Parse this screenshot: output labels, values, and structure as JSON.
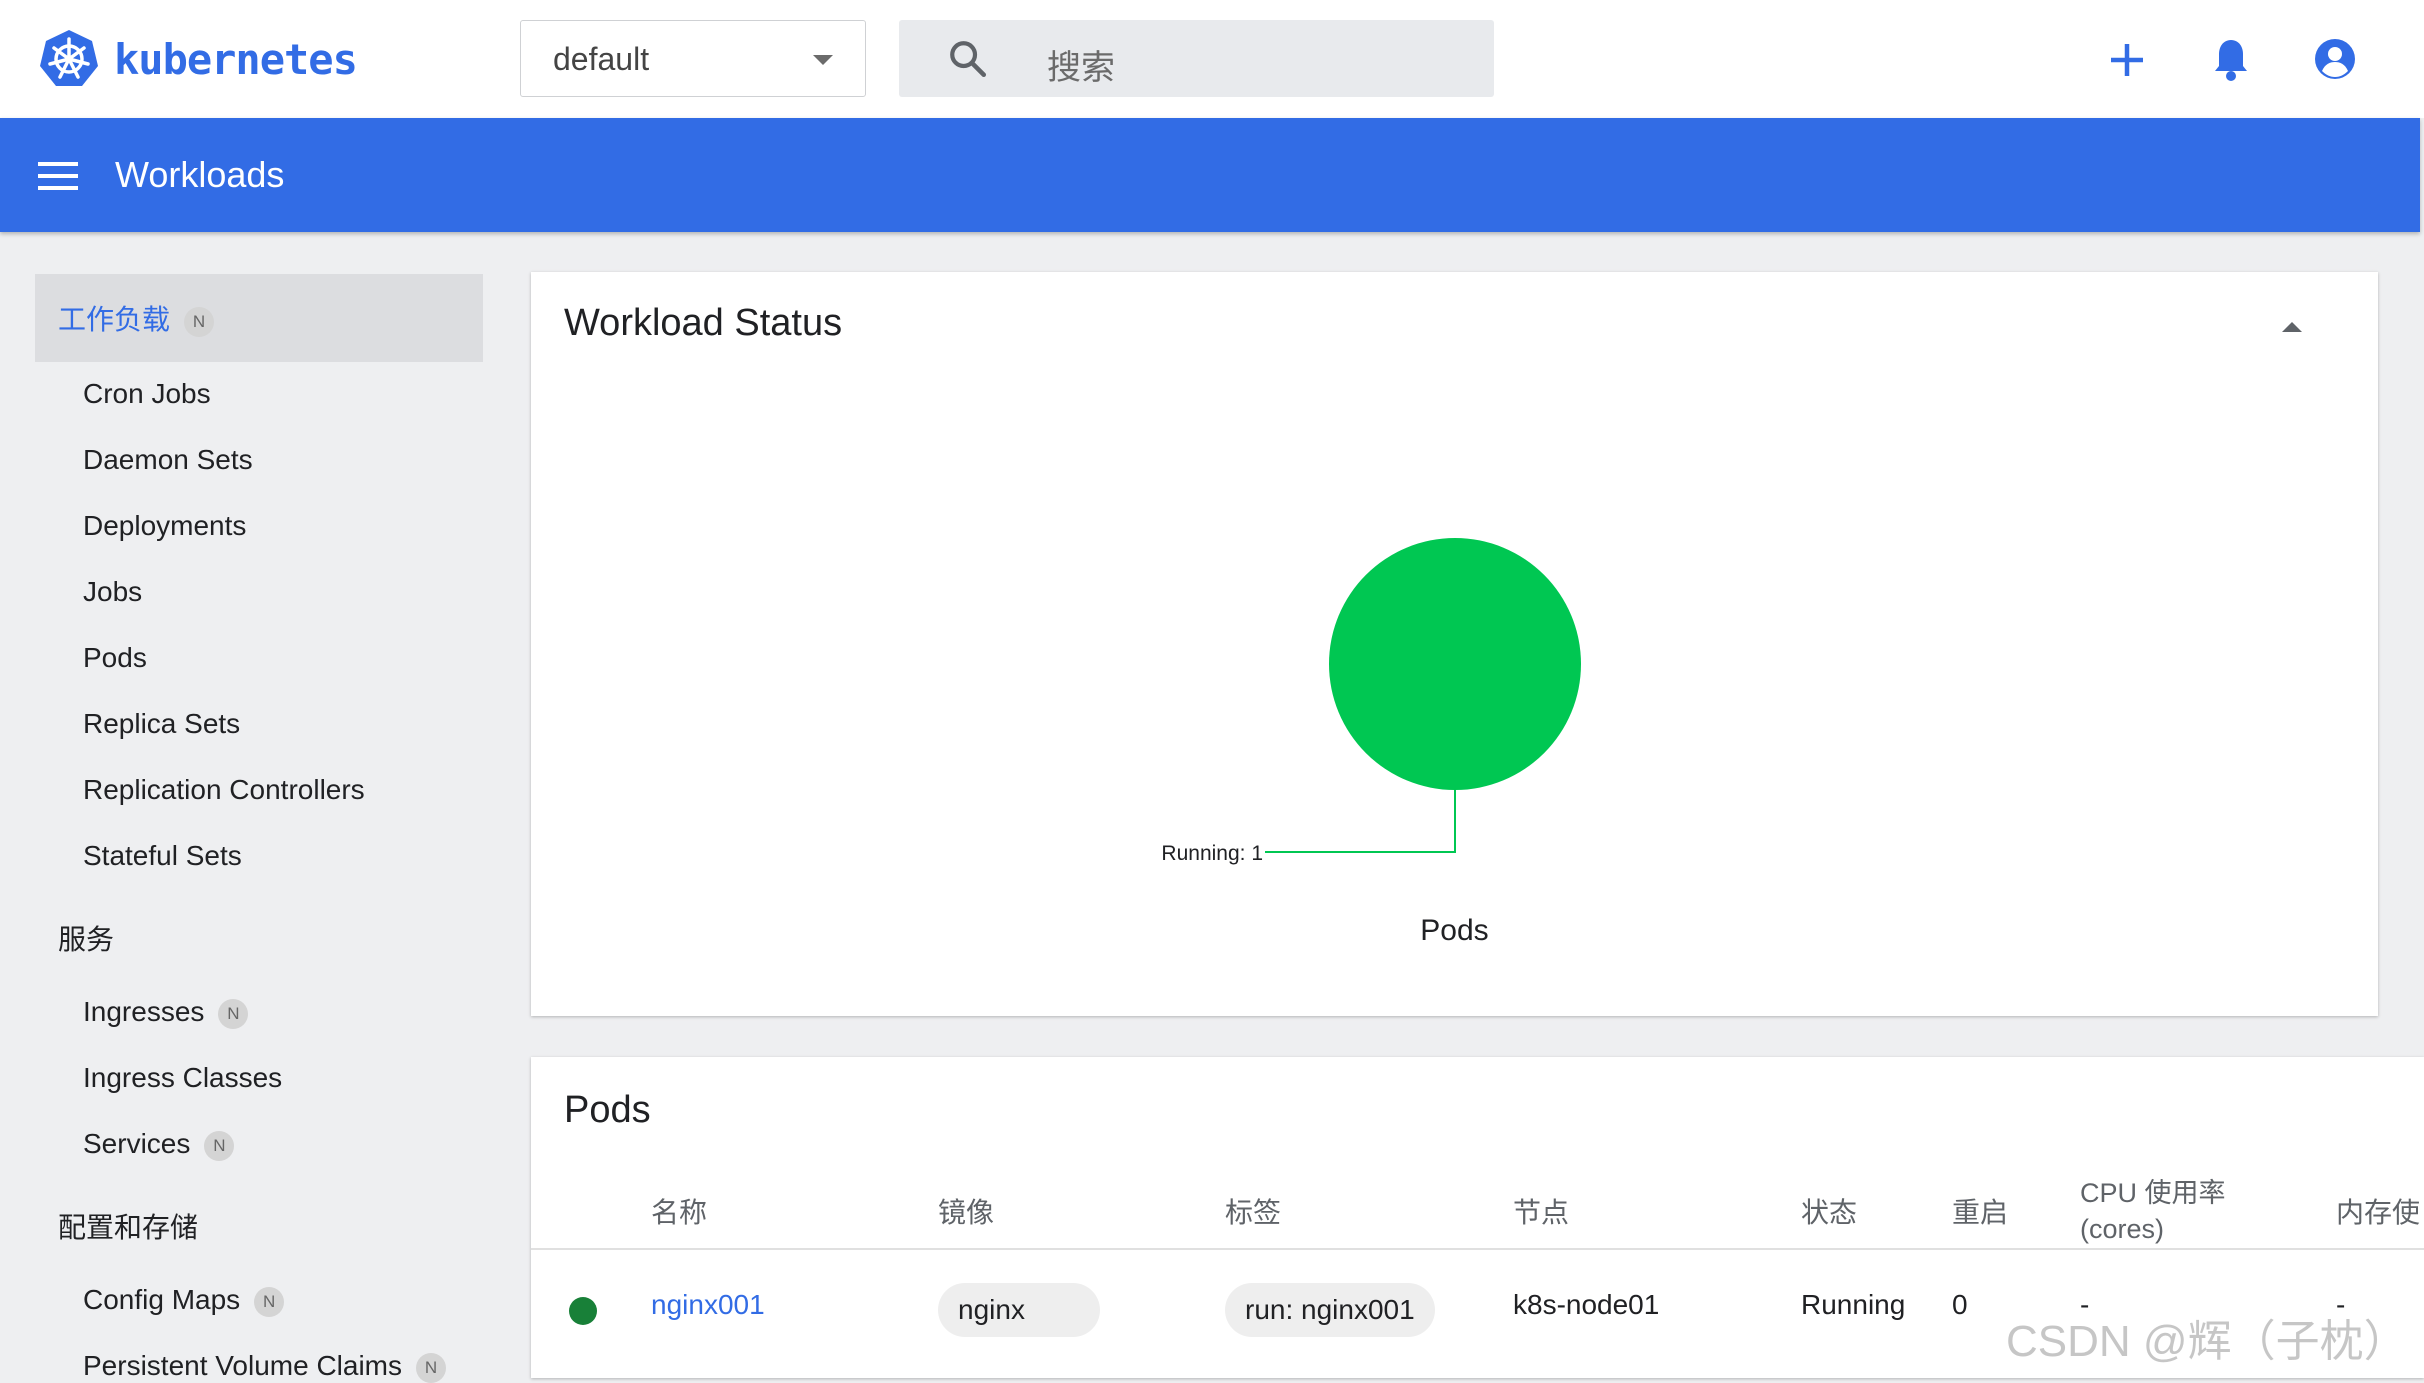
{
  "topbar": {
    "logo_text": "kubernetes",
    "namespace_value": "default",
    "search_placeholder": "搜索"
  },
  "appbar": {
    "title": "Workloads"
  },
  "sidebar": {
    "section_workloads": "工作负载",
    "section_workloads_badge": "N",
    "workload_items": [
      {
        "label": "Cron Jobs"
      },
      {
        "label": "Daemon Sets"
      },
      {
        "label": "Deployments"
      },
      {
        "label": "Jobs"
      },
      {
        "label": "Pods"
      },
      {
        "label": "Replica Sets"
      },
      {
        "label": "Replication Controllers"
      },
      {
        "label": "Stateful Sets"
      }
    ],
    "section_services": "服务",
    "service_items": [
      {
        "label": "Ingresses",
        "badge": "N"
      },
      {
        "label": "Ingress Classes"
      },
      {
        "label": "Services",
        "badge": "N"
      }
    ],
    "section_config": "配置和存储",
    "config_items": [
      {
        "label": "Config Maps",
        "badge": "N"
      },
      {
        "label": "Persistent Volume Claims",
        "badge": "N"
      }
    ]
  },
  "workload_status": {
    "title": "Workload Status",
    "chart_data": {
      "type": "pie",
      "title": "Pods",
      "categories": [
        "Running"
      ],
      "values": [
        1
      ],
      "labels": [
        "Running: 1"
      ],
      "colors": [
        "#00c752"
      ]
    }
  },
  "pods": {
    "title": "Pods",
    "columns": {
      "name": "名称",
      "image": "镜像",
      "labels": "标签",
      "node": "节点",
      "status": "状态",
      "restarts": "重启",
      "cpu_line1": "CPU 使用率",
      "cpu_line2": "(cores)",
      "memory": "内存使"
    },
    "rows": [
      {
        "name": "nginx001",
        "image": "nginx",
        "label": "run: nginx001",
        "node": "k8s-node01",
        "status": "Running",
        "restarts": "0",
        "cpu": "-",
        "memory": "-",
        "status_color": "#188038"
      }
    ]
  },
  "watermark": "CSDN @辉（子枕）"
}
